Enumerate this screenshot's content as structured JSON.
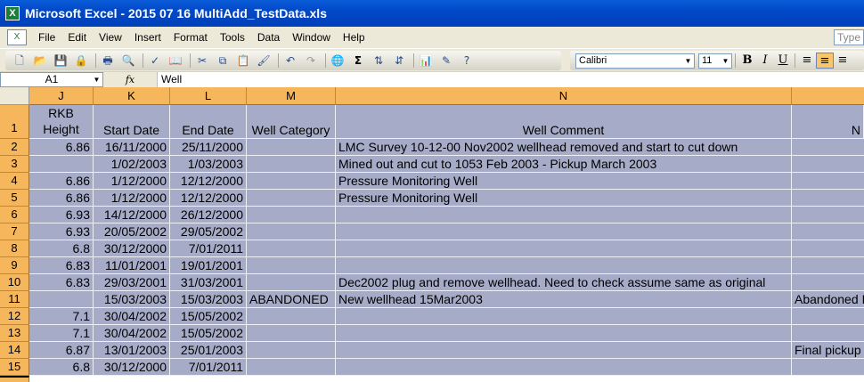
{
  "window": {
    "title": "Microsoft Excel - 2015 07 16 MultiAdd_TestData.xls",
    "app_icon": "excel-icon"
  },
  "menu": {
    "items": [
      "File",
      "Edit",
      "View",
      "Insert",
      "Format",
      "Tools",
      "Data",
      "Window",
      "Help"
    ],
    "help_placeholder": "Type"
  },
  "toolbar": {
    "font_name": "Calibri",
    "font_size": "11",
    "bold": "B",
    "italic": "I",
    "underline": "U",
    "sum_glyph": "Σ"
  },
  "formula_bar": {
    "name_box": "A1",
    "fx_label": "fx",
    "value": "Well"
  },
  "sheet": {
    "columns": [
      "J",
      "K",
      "L",
      "M",
      "N"
    ],
    "header_row": {
      "row_label": "1",
      "J_line1": "RKB",
      "J_line2": "Height",
      "K": "Start Date",
      "L": "End Date",
      "M": "Well Category",
      "N": "Well Comment",
      "O_partial": "N"
    },
    "rows": [
      {
        "n": "2",
        "J": "6.86",
        "K": "16/11/2000",
        "L": "25/11/2000",
        "M": "",
        "N": "LMC Survey 10-12-00 Nov2002 wellhead removed and start to cut down",
        "O": ""
      },
      {
        "n": "3",
        "J": "",
        "K": "1/02/2003",
        "L": "1/03/2003",
        "M": "",
        "N": "Mined out and cut to 1053 Feb 2003 - Pickup March 2003",
        "O": ""
      },
      {
        "n": "4",
        "J": "6.86",
        "K": "1/12/2000",
        "L": "12/12/2000",
        "M": "",
        "N": "Pressure Monitoring Well",
        "O": ""
      },
      {
        "n": "5",
        "J": "6.86",
        "K": "1/12/2000",
        "L": "12/12/2000",
        "M": "",
        "N": "Pressure Monitoring Well",
        "O": ""
      },
      {
        "n": "6",
        "J": "6.93",
        "K": "14/12/2000",
        "L": "26/12/2000",
        "M": "",
        "N": "",
        "O": ""
      },
      {
        "n": "7",
        "J": "6.93",
        "K": "20/05/2002",
        "L": "29/05/2002",
        "M": "",
        "N": "",
        "O": ""
      },
      {
        "n": "8",
        "J": "6.8",
        "K": "30/12/2000",
        "L": "7/01/2011",
        "M": "",
        "N": "",
        "O": ""
      },
      {
        "n": "9",
        "J": "6.83",
        "K": "11/01/2001",
        "L": "19/01/2001",
        "M": "",
        "N": "",
        "O": ""
      },
      {
        "n": "10",
        "J": "6.83",
        "K": "29/03/2001",
        "L": "31/03/2001",
        "M": "",
        "N": "Dec2002 plug and remove wellhead.  Need to check assume same as original",
        "O": ""
      },
      {
        "n": "11",
        "J": "",
        "K": "15/03/2003",
        "L": "15/03/2003",
        "M": "ABANDONED",
        "N": "New wellhead 15Mar2003",
        "O": "Abandoned I"
      },
      {
        "n": "12",
        "J": "7.1",
        "K": "30/04/2002",
        "L": "15/05/2002",
        "M": "",
        "N": "",
        "O": ""
      },
      {
        "n": "13",
        "J": "7.1",
        "K": "30/04/2002",
        "L": "15/05/2002",
        "M": "",
        "N": "",
        "O": ""
      },
      {
        "n": "14",
        "J": "6.87",
        "K": "13/01/2003",
        "L": "25/01/2003",
        "M": "",
        "N": "",
        "O": "Final pickup"
      },
      {
        "n": "15",
        "J": "6.8",
        "K": "30/12/2000",
        "L": "7/01/2011",
        "M": "",
        "N": "",
        "O": ""
      }
    ]
  }
}
